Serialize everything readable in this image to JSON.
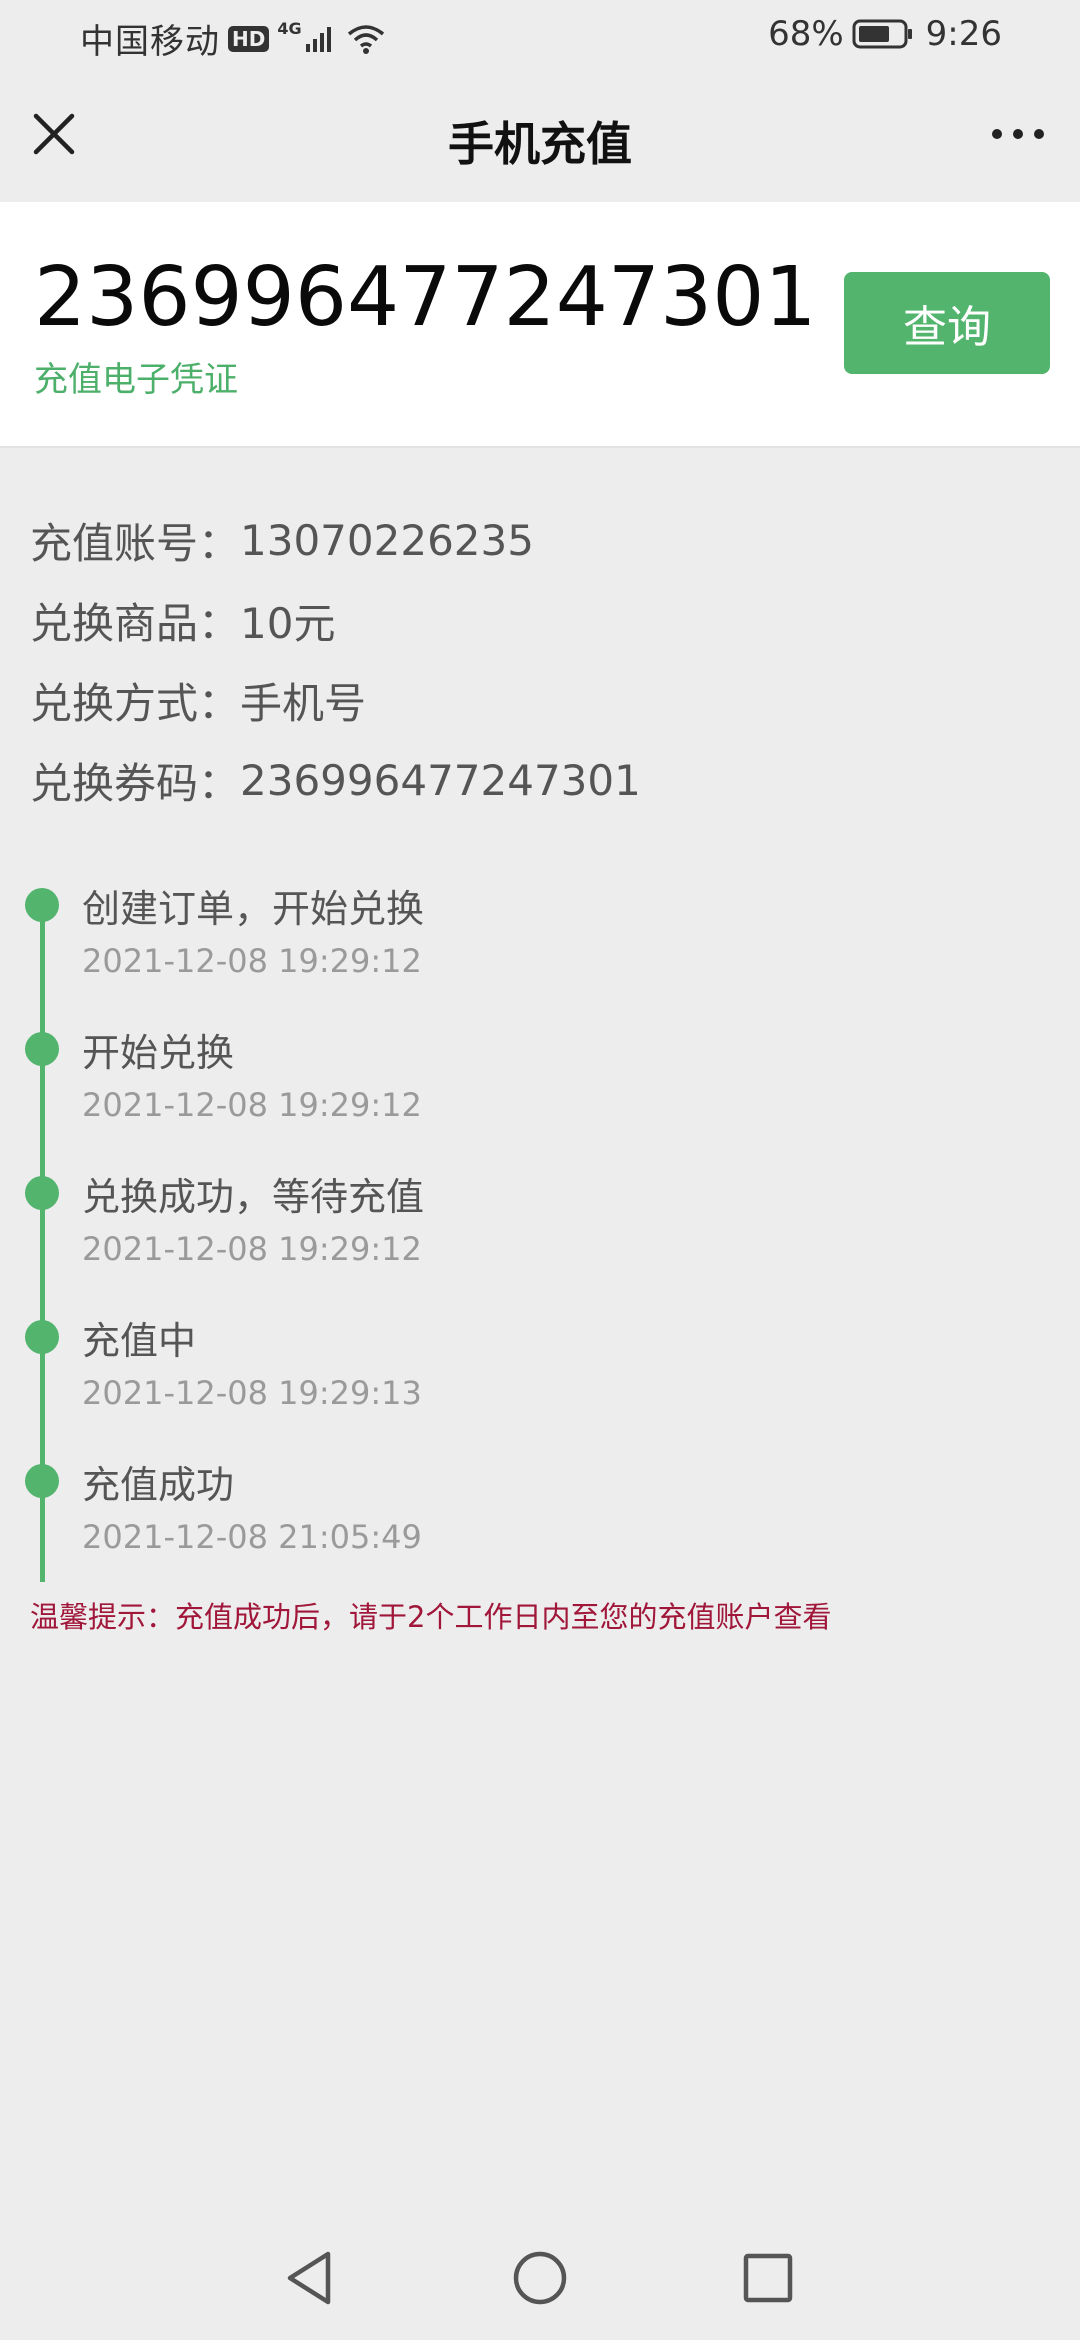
{
  "status_bar": {
    "carrier": "中国移动",
    "hd": "HD",
    "network": "4G",
    "battery": "68%",
    "time": "9:26"
  },
  "nav": {
    "title": "手机充值",
    "close_icon": "close-icon",
    "more_icon": "more-icon"
  },
  "voucher": {
    "code": "236996477247301",
    "subtitle": "充值电子凭证",
    "query_label": "查询",
    "accent_color": "#52b46d"
  },
  "info": [
    {
      "label": "充值账号：",
      "value": "13070226235"
    },
    {
      "label": "兑换商品：",
      "value": "10元"
    },
    {
      "label": "兑换方式：",
      "value": "手机号"
    },
    {
      "label": "兑换券码：",
      "value": "236996477247301"
    }
  ],
  "timeline": [
    {
      "title": "创建订单，开始兑换",
      "time": "2021-12-08 19:29:12"
    },
    {
      "title": "开始兑换",
      "time": "2021-12-08 19:29:12"
    },
    {
      "title": "兑换成功，等待充值",
      "time": "2021-12-08 19:29:12"
    },
    {
      "title": "充值中",
      "time": "2021-12-08 19:29:13"
    },
    {
      "title": "充值成功",
      "time": "2021-12-08 21:05:49"
    }
  ],
  "tip": "温馨提示：充值成功后，请于2个工作日内至您的充值账户查看",
  "tip_color": "#a0173a",
  "system_nav": {
    "back_icon": "back-triangle-icon",
    "home_icon": "home-circle-icon",
    "recents_icon": "recents-square-icon"
  }
}
